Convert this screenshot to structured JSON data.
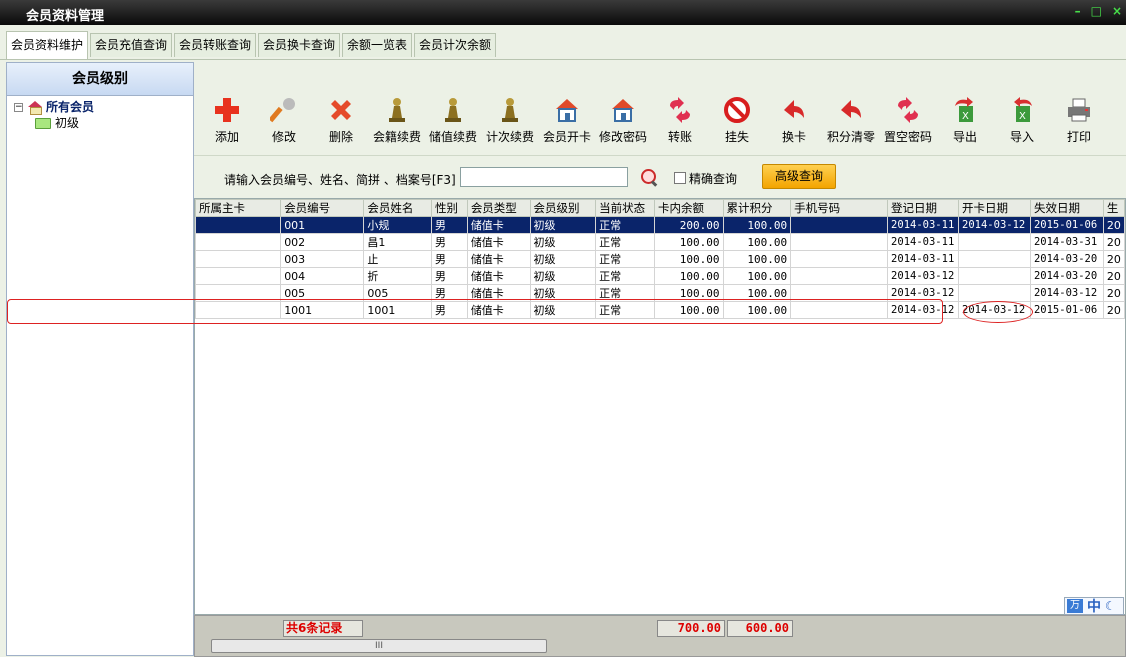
{
  "window": {
    "title": "会员资料管理",
    "minimize": "–",
    "restore": "□",
    "close": "×"
  },
  "tabs": [
    {
      "label": "会员资料维护"
    },
    {
      "label": "会员充值查询"
    },
    {
      "label": "会员转账查询"
    },
    {
      "label": "会员换卡查询"
    },
    {
      "label": "余额一览表"
    },
    {
      "label": "会员计次余额"
    }
  ],
  "left_panel": {
    "header": "会员级别",
    "tree": {
      "root": "所有会员",
      "expander": "−",
      "children": [
        "初级"
      ]
    }
  },
  "toolbar": [
    {
      "label": "添加",
      "icon": "plus-icon"
    },
    {
      "label": "修改",
      "icon": "wrench-icon"
    },
    {
      "label": "删除",
      "icon": "delete-x-icon"
    },
    {
      "label": "会籍续费",
      "icon": "pawn-icon"
    },
    {
      "label": "储值续费",
      "icon": "pawn-icon"
    },
    {
      "label": "计次续费",
      "icon": "pawn-icon"
    },
    {
      "label": "会员开卡",
      "icon": "house-icon"
    },
    {
      "label": "修改密码",
      "icon": "house-icon"
    },
    {
      "label": "转账",
      "icon": "transfer-icon"
    },
    {
      "label": "挂失",
      "icon": "no-entry-icon"
    },
    {
      "label": "换卡",
      "icon": "swap-icon"
    },
    {
      "label": "积分清零",
      "icon": "swap-icon"
    },
    {
      "label": "置空密码",
      "icon": "transfer-icon"
    },
    {
      "label": "导出",
      "icon": "export-icon"
    },
    {
      "label": "导入",
      "icon": "import-icon"
    },
    {
      "label": "打印",
      "icon": "printer-icon"
    }
  ],
  "search": {
    "label": "请输入会员编号、姓名、简拼 、档案号[F3]",
    "value": "",
    "exact_label": "精确查询",
    "exact_checked": false,
    "advanced_button": "高级查询"
  },
  "table": {
    "columns": [
      "所属主卡",
      "会员编号",
      "会员姓名",
      "性别",
      "会员类型",
      "会员级别",
      "当前状态",
      "卡内余额",
      "累计积分",
      "手机号码",
      "登记日期",
      "开卡日期",
      "失效日期",
      "生"
    ],
    "rows": [
      {
        "main_card": "",
        "no": "001",
        "name": "小规",
        "sex": "男",
        "type": "储值卡",
        "level": "初级",
        "status": "正常",
        "balance": "200.00",
        "points": "100.00",
        "phone": "",
        "reg_date": "2014-03-11",
        "open_date": "2014-03-12",
        "expire_date": "2015-01-06",
        "birth": "20"
      },
      {
        "main_card": "",
        "no": "002",
        "name": "昌1",
        "sex": "男",
        "type": "储值卡",
        "level": "初级",
        "status": "正常",
        "balance": "100.00",
        "points": "100.00",
        "phone": "",
        "reg_date": "2014-03-11",
        "open_date": "",
        "expire_date": "2014-03-31",
        "birth": "20"
      },
      {
        "main_card": "",
        "no": "003",
        "name": "止",
        "sex": "男",
        "type": "储值卡",
        "level": "初级",
        "status": "正常",
        "balance": "100.00",
        "points": "100.00",
        "phone": "",
        "reg_date": "2014-03-11",
        "open_date": "",
        "expire_date": "2014-03-20",
        "birth": "20"
      },
      {
        "main_card": "",
        "no": "004",
        "name": "折",
        "sex": "男",
        "type": "储值卡",
        "level": "初级",
        "status": "正常",
        "balance": "100.00",
        "points": "100.00",
        "phone": "",
        "reg_date": "2014-03-12",
        "open_date": "",
        "expire_date": "2014-03-20",
        "birth": "20"
      },
      {
        "main_card": "",
        "no": "005",
        "name": "005",
        "sex": "男",
        "type": "储值卡",
        "level": "初级",
        "status": "正常",
        "balance": "100.00",
        "points": "100.00",
        "phone": "",
        "reg_date": "2014-03-12",
        "open_date": "",
        "expire_date": "2014-03-12",
        "birth": "20"
      },
      {
        "main_card": "",
        "no": "1001",
        "name": "1001",
        "sex": "男",
        "type": "储值卡",
        "level": "初级",
        "status": "正常",
        "balance": "100.00",
        "points": "100.00",
        "phone": "",
        "reg_date": "2014-03-12",
        "open_date": "2014-03-12",
        "expire_date": "2015-01-06",
        "birth": "20"
      }
    ],
    "selected_row": 0
  },
  "footer": {
    "record_count": "共6条记录",
    "total_balance": "700.00",
    "total_points": "600.00",
    "scroll_grip": "III"
  },
  "ime": {
    "logo": "万",
    "mode": "中",
    "moon": "☾"
  },
  "colors": {
    "selection": "#0a246a",
    "accent_button": "#f3a400",
    "annotation": "#dd2222"
  }
}
